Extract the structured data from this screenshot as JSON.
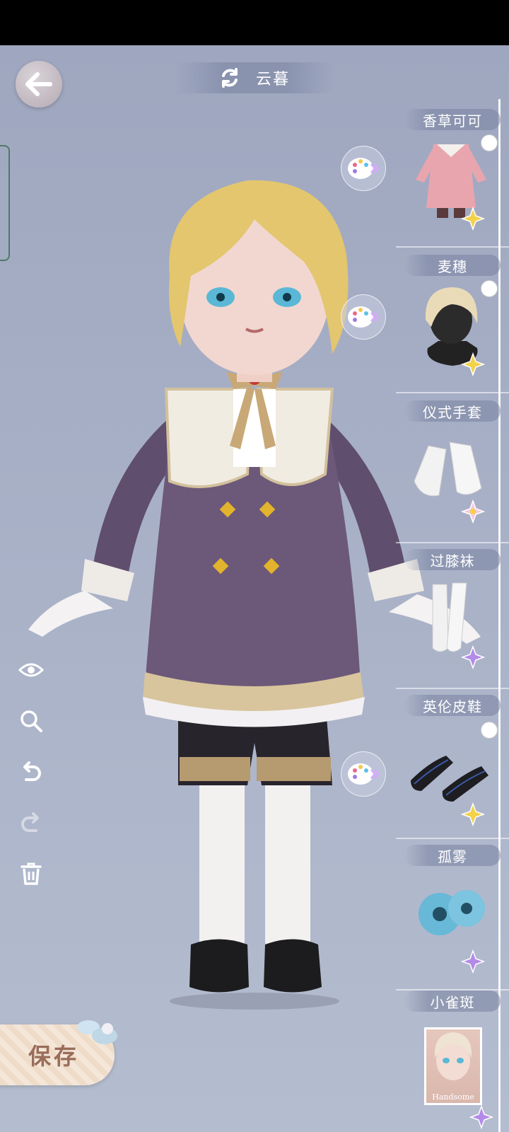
{
  "header": {
    "outfit_name": "云暮"
  },
  "actions": {
    "save_label": "保存"
  },
  "tools": [
    {
      "icon": "eye-icon"
    },
    {
      "icon": "zoom-icon"
    },
    {
      "icon": "undo-icon"
    },
    {
      "icon": "redo-icon"
    },
    {
      "icon": "trash-icon"
    }
  ],
  "items": [
    {
      "label": "香草可可",
      "category": "dress",
      "rarity": "gold-star",
      "dyeable": true
    },
    {
      "label": "麦穗",
      "category": "hair",
      "rarity": "gold-star",
      "dyeable": true
    },
    {
      "label": "仪式手套",
      "category": "gloves",
      "rarity": "rainbow-star",
      "dyeable": false
    },
    {
      "label": "过膝袜",
      "category": "socks",
      "rarity": "purple-star",
      "dyeable": false
    },
    {
      "label": "英伦皮鞋",
      "category": "shoes",
      "rarity": "gold-star",
      "dyeable": true
    },
    {
      "label": "孤雾",
      "category": "eyes",
      "rarity": "purple-star",
      "dyeable": false
    },
    {
      "label": "小雀斑",
      "category": "makeup",
      "rarity": "purple-star",
      "dyeable": false,
      "thumb_text": "Handsome"
    }
  ],
  "colors": {
    "background": "#a7afc6",
    "dress_purple": "#6c5879",
    "hair_blonde": "#e3c66e",
    "save_text": "#9a6d5b",
    "gold_star": "#f3d24a",
    "purple_star": "#b48ae8"
  }
}
